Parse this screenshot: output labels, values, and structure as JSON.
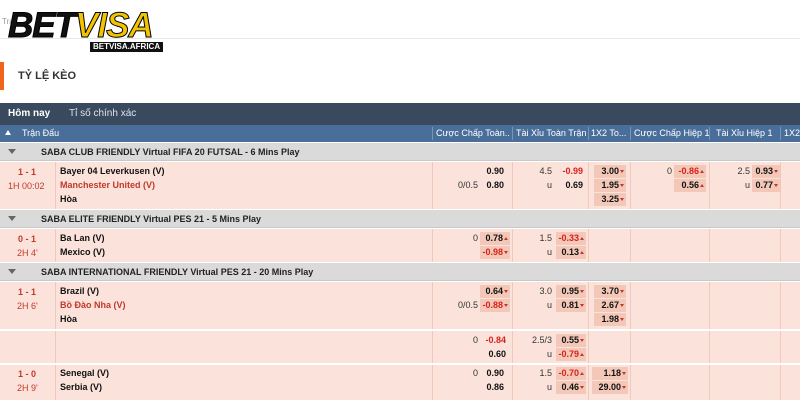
{
  "logo": {
    "main": "BET",
    "accent": "VISA",
    "sub": "BETVISA.AFRICA"
  },
  "breadcrumb": "Tra",
  "page_title": "TỶ LỆ KÈO",
  "tabs": [
    {
      "label": "Hôm nay",
      "active": true
    },
    {
      "label": "Tỉ số chính xác",
      "active": false
    }
  ],
  "columns": [
    "Trận Đấu",
    "Cược Chấp Toàn...",
    "Tài Xỉu Toàn Trận",
    "1X2 To...",
    "Cược Chấp Hiệp 1",
    "Tài Xỉu Hiệp 1",
    "1X2"
  ],
  "leagues": [
    {
      "name": "SABA CLUB FRIENDLY Virtual FIFA 20 FUTSAL - 6 Mins Play",
      "matches": [
        {
          "score": "1 - 1",
          "time": "1H 00:02",
          "home": "Bayer 04 Leverkusen (V)",
          "away": "Manchester United (V)",
          "draw": "Hòa",
          "hdp_line": "0/0.5",
          "hdp_home": "0.90",
          "hdp_away": "0.80",
          "ou_line": "4.5",
          "ou_u": "u",
          "ou_over": "-0.99",
          "ou_under": "0.69",
          "x12": [
            "3.00",
            "1.95",
            "3.25"
          ],
          "h1_hdp_line": "0",
          "h1_hdp_home": "-0.86",
          "h1_hdp_away": "0.56",
          "h1_ou_line": "2.5",
          "h1_ou_u": "u",
          "h1_ou_over": "0.93",
          "h1_ou_under": "0.77"
        }
      ]
    },
    {
      "name": "SABA ELITE FRIENDLY Virtual PES 21 - 5 Mins Play",
      "matches": [
        {
          "score": "0 - 1",
          "time": "2H 4'",
          "home": "Ba Lan (V)",
          "away": "Mexico (V)",
          "hdp_line": "0",
          "hdp_home": "0.78",
          "hdp_away": "-0.98",
          "ou_line": "1.5",
          "ou_u": "u",
          "ou_over": "-0.33",
          "ou_under": "0.13"
        }
      ]
    },
    {
      "name": "SABA INTERNATIONAL FRIENDLY Virtual PES 21 - 20 Mins Play",
      "matches": [
        {
          "score": "1 - 1",
          "time": "2H 6'",
          "home": "Brazil (V)",
          "away": "Bồ Đào Nha (V)",
          "draw": "Hòa",
          "hdp_line": "0/0.5",
          "hdp_home": "0.64",
          "hdp_away": "-0.88",
          "ou_line": "3.0",
          "ou_u": "u",
          "ou_over": "0.95",
          "ou_under": "0.81",
          "x12": [
            "3.70",
            "2.67",
            "1.98"
          ],
          "alt_hdp_line": "0",
          "alt_hdp_home": "-0.84",
          "alt_hdp_away": "0.60",
          "alt_ou_line": "2.5/3",
          "alt_ou_u": "u",
          "alt_ou_over": "0.55",
          "alt_ou_under": "-0.79"
        },
        {
          "score": "1 - 0",
          "time": "2H 9'",
          "home": "Senegal (V)",
          "away": "Serbia (V)",
          "hdp_line": "0",
          "hdp_home": "0.90",
          "hdp_away": "0.86",
          "ou_line": "1.5",
          "ou_u": "u",
          "ou_over": "-0.70",
          "ou_under": "0.46",
          "x12": [
            "1.18",
            "29.00"
          ]
        }
      ]
    }
  ],
  "colors": {
    "accent": "#f0641e",
    "tab_bar": "#394a5e",
    "header": "#4a6e9a",
    "row_bg": "#fbe3db",
    "negative": "#d9211b"
  }
}
